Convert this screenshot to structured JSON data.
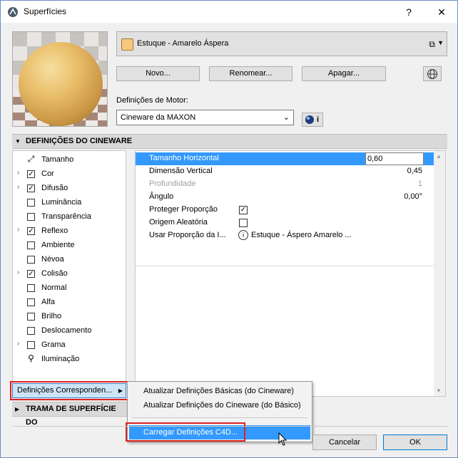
{
  "window": {
    "title": "Superfícies",
    "help_label": "?",
    "close_label": "✕"
  },
  "surface": {
    "name": "Estuque - Amarelo Áspera",
    "swatch_color": "#f7c97c"
  },
  "buttons": {
    "new": "Novo...",
    "rename": "Renomear...",
    "delete": "Apagar..."
  },
  "engine": {
    "label": "Definições de Motor:",
    "value": "Cineware da MAXON",
    "info_label": "i"
  },
  "cineware_section": {
    "title": "DEFINIÇÕES DO CINEWARE"
  },
  "channels": [
    {
      "label": "Tamanho",
      "expandable": false,
      "checkbox": "none",
      "icon": "size-icon"
    },
    {
      "label": "Cor",
      "expandable": true,
      "checkbox": "checked"
    },
    {
      "label": "Difusão",
      "expandable": true,
      "checkbox": "checked"
    },
    {
      "label": "Luminância",
      "expandable": false,
      "checkbox": "unchecked"
    },
    {
      "label": "Transparência",
      "expandable": false,
      "checkbox": "unchecked"
    },
    {
      "label": "Reflexo",
      "expandable": true,
      "checkbox": "checked"
    },
    {
      "label": "Ambiente",
      "expandable": false,
      "checkbox": "unchecked"
    },
    {
      "label": "Névoa",
      "expandable": false,
      "checkbox": "unchecked"
    },
    {
      "label": "Colisão",
      "expandable": true,
      "checkbox": "checked"
    },
    {
      "label": "Normal",
      "expandable": false,
      "checkbox": "unchecked"
    },
    {
      "label": "Alfa",
      "expandable": false,
      "checkbox": "unchecked"
    },
    {
      "label": "Brilho",
      "expandable": false,
      "checkbox": "unchecked"
    },
    {
      "label": "Deslocamento",
      "expandable": false,
      "checkbox": "unchecked"
    },
    {
      "label": "Grama",
      "expandable": true,
      "checkbox": "unchecked"
    },
    {
      "label": "Iluminação",
      "expandable": false,
      "checkbox": "none",
      "icon": "lightbulb-icon"
    }
  ],
  "properties": {
    "horizontal_size": {
      "label": "Tamanho Horizontal",
      "value": "0,60"
    },
    "vertical_size": {
      "label": "Dimensão Vertical",
      "value": "0,45"
    },
    "depth": {
      "label": "Profundidade",
      "value": "1"
    },
    "angle": {
      "label": "Ângulo",
      "value": "0,00°"
    },
    "keep_ratio": {
      "label": "Proteger Proporção",
      "checked": true
    },
    "random_origin": {
      "label": "Origem Aleatória",
      "checked": false
    },
    "use_ratio": {
      "label": "Usar Proporção da I...",
      "value": "Estuque - Áspero Amarelo ..."
    }
  },
  "match_button": {
    "label": "Definições Corresponden..."
  },
  "menu": {
    "items": [
      "Atualizar Definições Básicas (do Cineware)",
      "Atualizar Definições do Cineware (do Básico)",
      "Carregar Definições C4D..."
    ]
  },
  "texture_section": {
    "title": "TRAMA DE SUPERFÍCIE DO"
  },
  "footer": {
    "cancel": "Cancelar",
    "ok": "OK"
  }
}
